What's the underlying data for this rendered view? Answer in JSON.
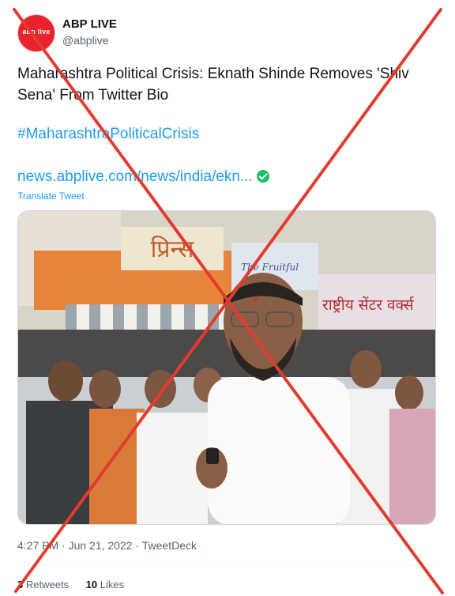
{
  "account": {
    "name": "ABP LIVE",
    "handle": "@abplive",
    "avatar_logo": "abp live"
  },
  "tweet": {
    "text": "Maharashtra Political Crisis: Eknath Shinde Removes 'Shiv Sena' From Twitter Bio",
    "hashtag": "#MaharashtraPoliticalCrisis",
    "link": "news.abplive.com/news/india/ekn...",
    "translate_label": "Translate Tweet",
    "timestamp": "4:27 PM · Jun 21, 2022 · TweetDeck",
    "retweets_count": "3",
    "retweets_label": "Retweets",
    "likes_count": "10",
    "likes_label": "Likes"
  },
  "photo": {
    "shop_sign_1": "प्रिन्स",
    "shop_sign_2": "राष्ट्रीय सेंटर वर्क्स",
    "shop_sign_3": "The Fruitful"
  },
  "colors": {
    "accent_blue": "#1d9bf0",
    "cross_red": "#e23b2f",
    "brand_red": "#e8232b",
    "verified_green": "#17bf63"
  },
  "icons": {
    "verified": "verified-check-icon",
    "cross": "false-mark-cross"
  }
}
